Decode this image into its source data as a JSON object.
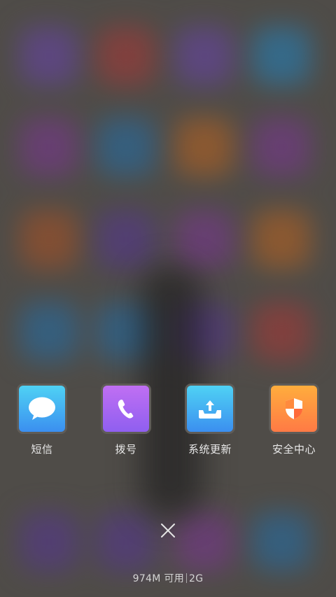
{
  "recent_apps": [
    {
      "label": "短信",
      "icon": "message-bubble-icon",
      "color_top": "#4fd2f4",
      "color_bottom": "#3b8ff0"
    },
    {
      "label": "拨号",
      "icon": "phone-icon",
      "color_top": "#c06ff3",
      "color_bottom": "#8f5ff0"
    },
    {
      "label": "系统更新",
      "icon": "upload-tray-icon",
      "color_top": "#4fd2f4",
      "color_bottom": "#3b8ff0"
    },
    {
      "label": "安全中心",
      "icon": "shield-icon",
      "color_top": "#ffad3d",
      "color_bottom": "#ff7a45"
    }
  ],
  "close_button": {
    "icon": "close-icon"
  },
  "memory_status": {
    "available": "974M 可用",
    "total": "2G"
  }
}
